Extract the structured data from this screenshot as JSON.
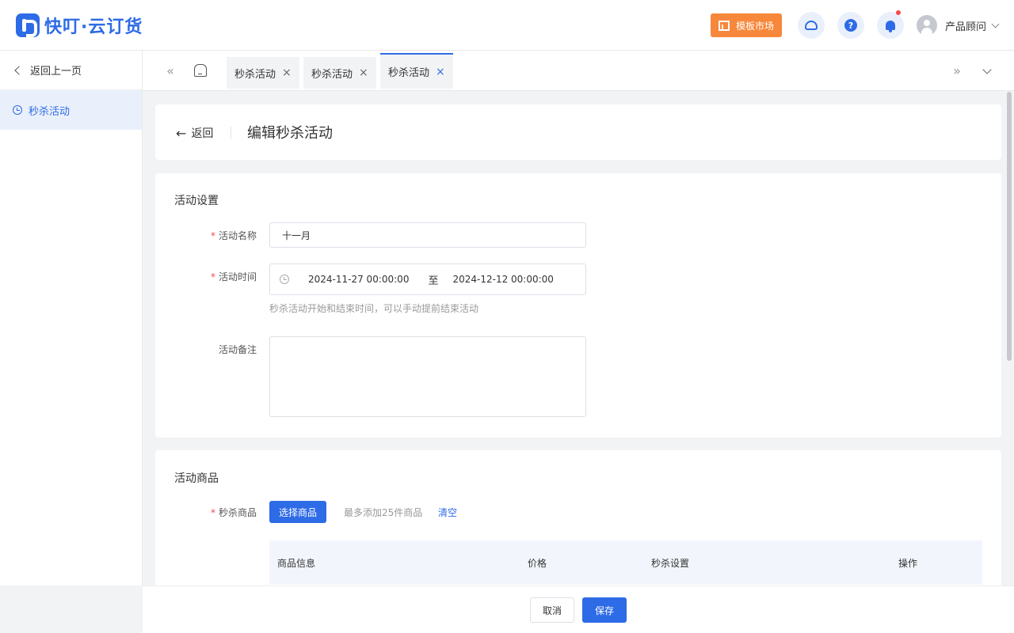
{
  "header": {
    "logo_text": "快叮·云订货",
    "market_label": "模板市场",
    "help_label": "?",
    "user_name": "产品顾问"
  },
  "sidebar": {
    "back_label": "返回上一页",
    "items": [
      {
        "label": "秒杀活动"
      }
    ]
  },
  "tabs": {
    "prev_glyph": "«",
    "next_glyph": "»",
    "close_glyph": "×",
    "items": [
      {
        "label": "秒杀活动"
      },
      {
        "label": "秒杀活动"
      },
      {
        "label": "秒杀活动"
      }
    ]
  },
  "page": {
    "back_label": "返回",
    "arrow_glyph": "←",
    "title": "编辑秒杀活动"
  },
  "settings": {
    "section_title": "活动设置",
    "required_mark": "*",
    "name_label": "活动名称",
    "name_value": "十一月",
    "time_label": "活动时间",
    "start_time": "2024-11-27 00:00:00",
    "to_label": "至",
    "end_time": "2024-12-12 00:00:00",
    "time_hint": "秒杀活动开始和结束时间，可以手动提前结束活动",
    "remark_label": "活动备注"
  },
  "products": {
    "section_title": "活动商品",
    "label": "秒杀商品",
    "select_button": "选择商品",
    "limit_hint": "最多添加25件商品",
    "clear_link": "清空",
    "columns": [
      "商品信息",
      "价格",
      "秒杀设置",
      "操作"
    ]
  },
  "footer": {
    "cancel_label": "取消",
    "save_label": "保存"
  },
  "colors": {
    "primary": "#2e6be6",
    "market_orange": "#f7873a",
    "required_red": "#f5484a"
  }
}
